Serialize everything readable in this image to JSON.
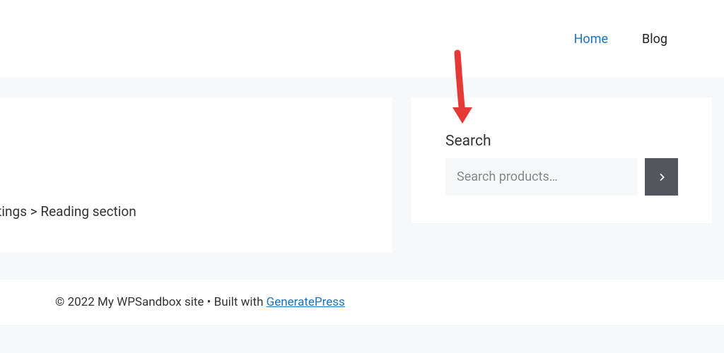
{
  "nav": {
    "home": "Home",
    "blog": "Blog"
  },
  "main": {
    "reading_text": "ttings > Reading section"
  },
  "sidebar": {
    "search_title": "Search",
    "search_placeholder": "Search products…"
  },
  "footer": {
    "copyright": "© 2022 My WPSandbox site • Built with ",
    "link_text": "GeneratePress"
  }
}
